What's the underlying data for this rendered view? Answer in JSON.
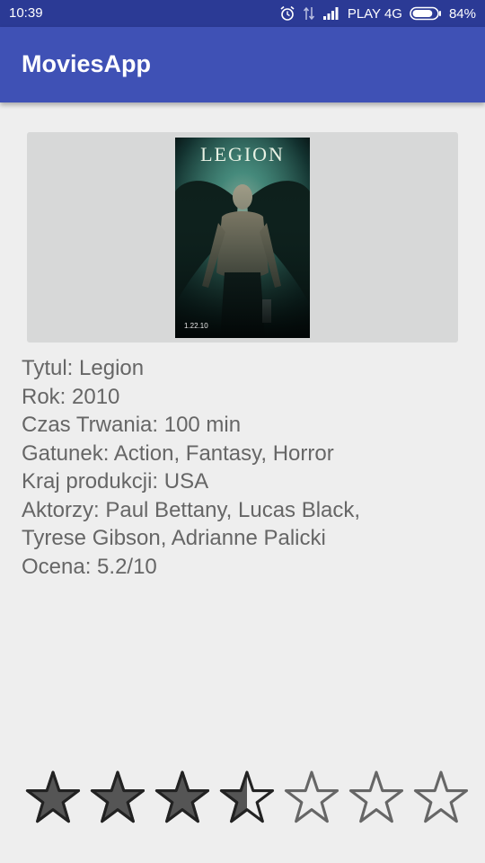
{
  "status_bar": {
    "time": "10:39",
    "carrier": "PLAY 4G",
    "battery": "84%",
    "battery_level": 0.84,
    "icons": [
      "alarm-icon",
      "data-transfer-icon",
      "signal-icon",
      "battery-icon"
    ]
  },
  "app_bar": {
    "title": "MoviesApp"
  },
  "poster": {
    "title": "LEGION",
    "date": "1.22.10"
  },
  "details": {
    "title_line": "Tytul: Legion",
    "year_line": "Rok: 2010",
    "duration_line": "Czas Trwania: 100 min",
    "genre_line": "Gatunek: Action, Fantasy, Horror",
    "country_line": "Kraj produkcji: USA",
    "actors_line1": "Aktorzy: Paul Bettany, Lucas Black,",
    "actors_line2": "Tyrese Gibson, Adrianne Palicki",
    "rating_line": "Ocena: 5.2/10"
  },
  "rating": {
    "value": 3.5,
    "max": 7
  },
  "colors": {
    "status_bar": "#2b3a95",
    "app_bar": "#3f51b5",
    "background": "#eeeeee",
    "text": "#666666",
    "star_filled": "#555555",
    "star_outline": "#222222"
  }
}
